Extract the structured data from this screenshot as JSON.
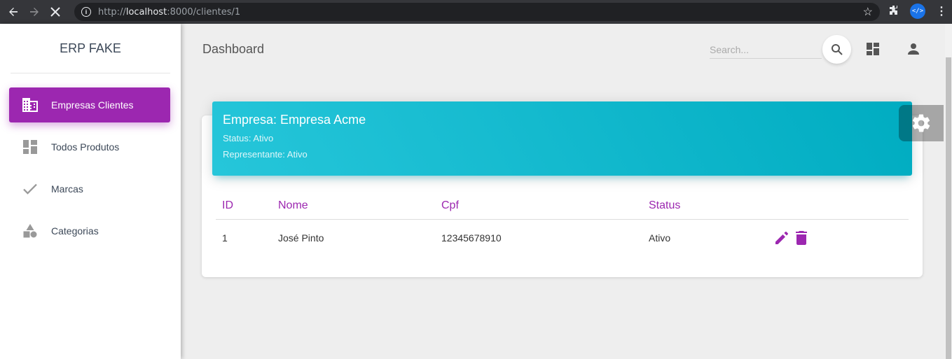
{
  "browser": {
    "url_prefix": "http://",
    "url_host": "localhost",
    "url_rest": ":8000/clientes/1"
  },
  "sidebar": {
    "brand": "ERP FAKE",
    "items": [
      {
        "label": "Empresas Clientes",
        "icon": "business-icon",
        "active": true
      },
      {
        "label": "Todos Produtos",
        "icon": "dashboard-icon",
        "active": false
      },
      {
        "label": "Marcas",
        "icon": "check-icon",
        "active": false
      },
      {
        "label": "Categorias",
        "icon": "category-icon",
        "active": false
      }
    ]
  },
  "header": {
    "title": "Dashboard",
    "search_placeholder": "Search..."
  },
  "card": {
    "title": "Empresa: Empresa Acme",
    "status": "Status: Ativo",
    "representative": "Representante: Ativo"
  },
  "table": {
    "columns": [
      "ID",
      "Nome",
      "Cpf",
      "Status"
    ],
    "rows": [
      {
        "id": "1",
        "nome": "José Pinto",
        "cpf": "12345678910",
        "status": "Ativo"
      }
    ]
  },
  "colors": {
    "primary": "#9c27b0",
    "header_start": "#26c6da",
    "header_end": "#00acc1"
  }
}
